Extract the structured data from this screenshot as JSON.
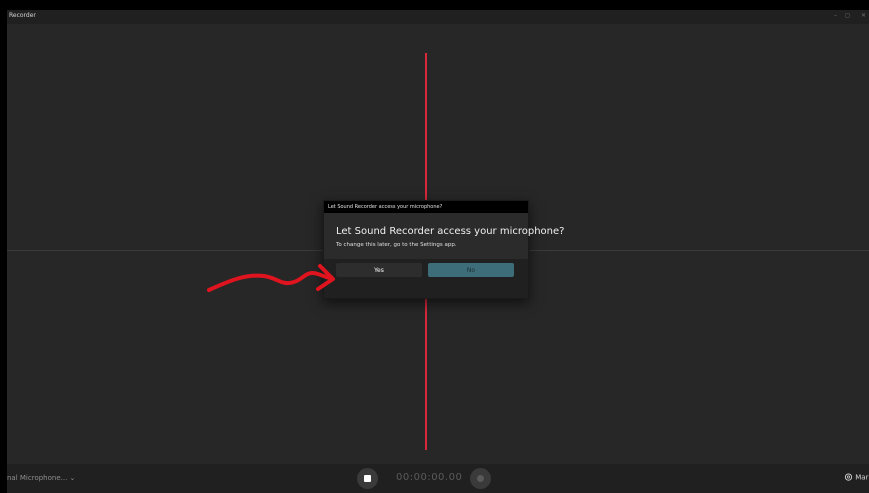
{
  "window": {
    "title": "Recorder",
    "controls": {
      "minimize": "–",
      "maximize": "◻",
      "close": "✕"
    }
  },
  "dialog": {
    "title_bar": "Let Sound Recorder access your microphone?",
    "heading": "Let Sound Recorder access your microphone?",
    "body": "To change this later, go to the Settings app.",
    "yes_label": "Yes",
    "no_label": "No"
  },
  "bottom_bar": {
    "mic_selector": "nal Microphone... ⌄",
    "timer": "00:00:00.00",
    "marker_label": "Mar"
  },
  "colors": {
    "playhead": "#d8283a",
    "annotation_arrow": "#e0141e",
    "no_button": "#3e6d7a"
  },
  "icons": {
    "marker": "location-pin-icon",
    "stop": "stop-icon",
    "record": "record-icon"
  }
}
